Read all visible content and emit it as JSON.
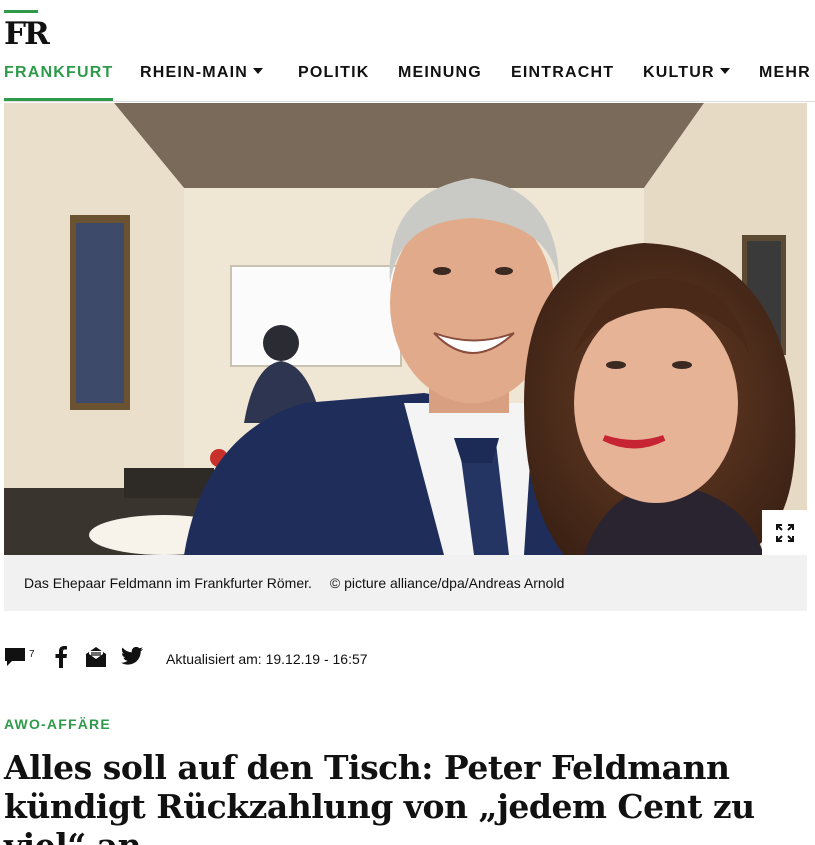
{
  "brand": {
    "logo_text": "FR",
    "accent_color": "#2e9a4a"
  },
  "nav": {
    "items": [
      {
        "label": "FRANKFURT",
        "active": true,
        "dropdown": false
      },
      {
        "label": "RHEIN-MAIN",
        "active": false,
        "dropdown": true
      },
      {
        "label": "POLITIK",
        "active": false,
        "dropdown": false
      },
      {
        "label": "MEINUNG",
        "active": false,
        "dropdown": false
      },
      {
        "label": "EINTRACHT",
        "active": false,
        "dropdown": false
      },
      {
        "label": "KULTUR",
        "active": false,
        "dropdown": true
      },
      {
        "label": "MEHR",
        "active": false,
        "dropdown": false
      }
    ]
  },
  "hero": {
    "caption": "Das Ehepaar Feldmann im Frankfurter Römer.",
    "credit": "© picture alliance/dpa/Andreas Arnold",
    "expand_icon": "expand-icon"
  },
  "toolbar": {
    "comment_count": "7",
    "icons": [
      "comment-icon",
      "facebook-icon",
      "email-icon",
      "twitter-icon"
    ],
    "updated": "Aktualisiert am: 19.12.19 - 16:57"
  },
  "article": {
    "kicker": "AWO-AFFÄRE",
    "headline": "Alles soll auf den Tisch: Peter Feldmann kündigt Rückzahlung von „jedem Cent zu viel“ an"
  }
}
